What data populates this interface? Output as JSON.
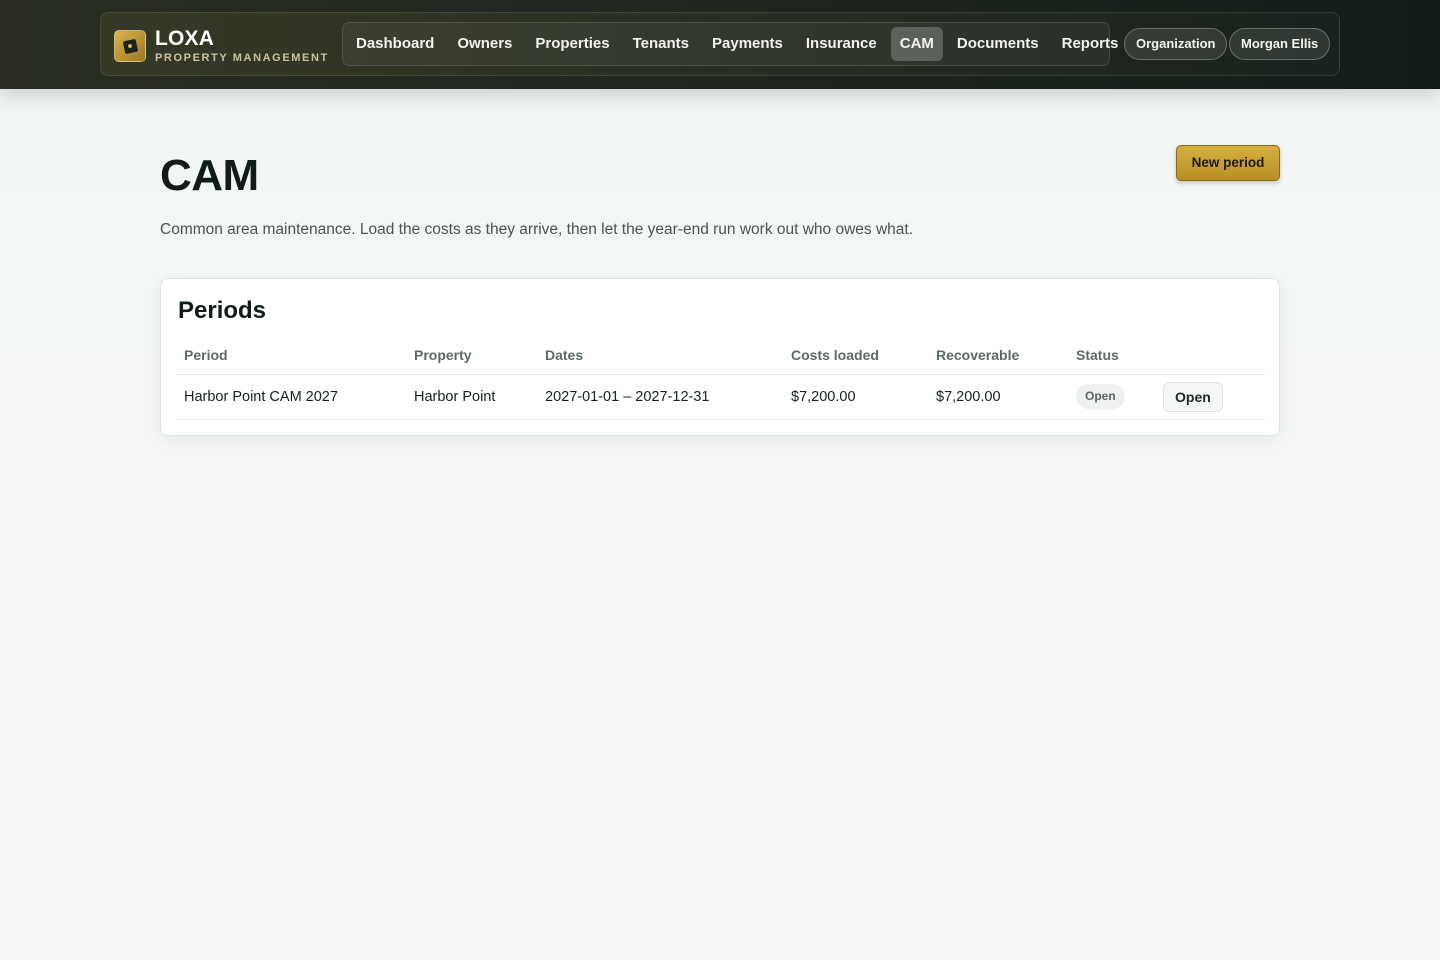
{
  "brand": {
    "name": "LOXA",
    "subtitle": "PROPERTY MANAGEMENT"
  },
  "nav": {
    "items": [
      {
        "label": "Dashboard",
        "active": false
      },
      {
        "label": "Owners",
        "active": false
      },
      {
        "label": "Properties",
        "active": false
      },
      {
        "label": "Tenants",
        "active": false
      },
      {
        "label": "Payments",
        "active": false
      },
      {
        "label": "Insurance",
        "active": false
      },
      {
        "label": "CAM",
        "active": true
      },
      {
        "label": "Documents",
        "active": false
      },
      {
        "label": "Reports",
        "active": false
      }
    ]
  },
  "header": {
    "organization_label": "Organization",
    "user_name": "Morgan Ellis"
  },
  "page": {
    "title": "CAM",
    "description": "Common area maintenance. Load the costs as they arrive, then let the year-end run work out who owes what.",
    "new_button_label": "New period"
  },
  "periods": {
    "title": "Periods",
    "columns": [
      "Period",
      "Property",
      "Dates",
      "Costs loaded",
      "Recoverable",
      "Status",
      ""
    ],
    "rows": [
      {
        "period": "Harbor Point CAM 2027",
        "property": "Harbor Point",
        "dates": "2027-01-01 – 2027-12-31",
        "costs_loaded": "$7,200.00",
        "recoverable": "$7,200.00",
        "status": "Open",
        "action_label": "Open"
      }
    ]
  },
  "colors": {
    "accent_gold": "#c9a232",
    "nav_dark": "#1e251d"
  },
  "icons": {
    "brand": "loxa-logo-icon"
  }
}
